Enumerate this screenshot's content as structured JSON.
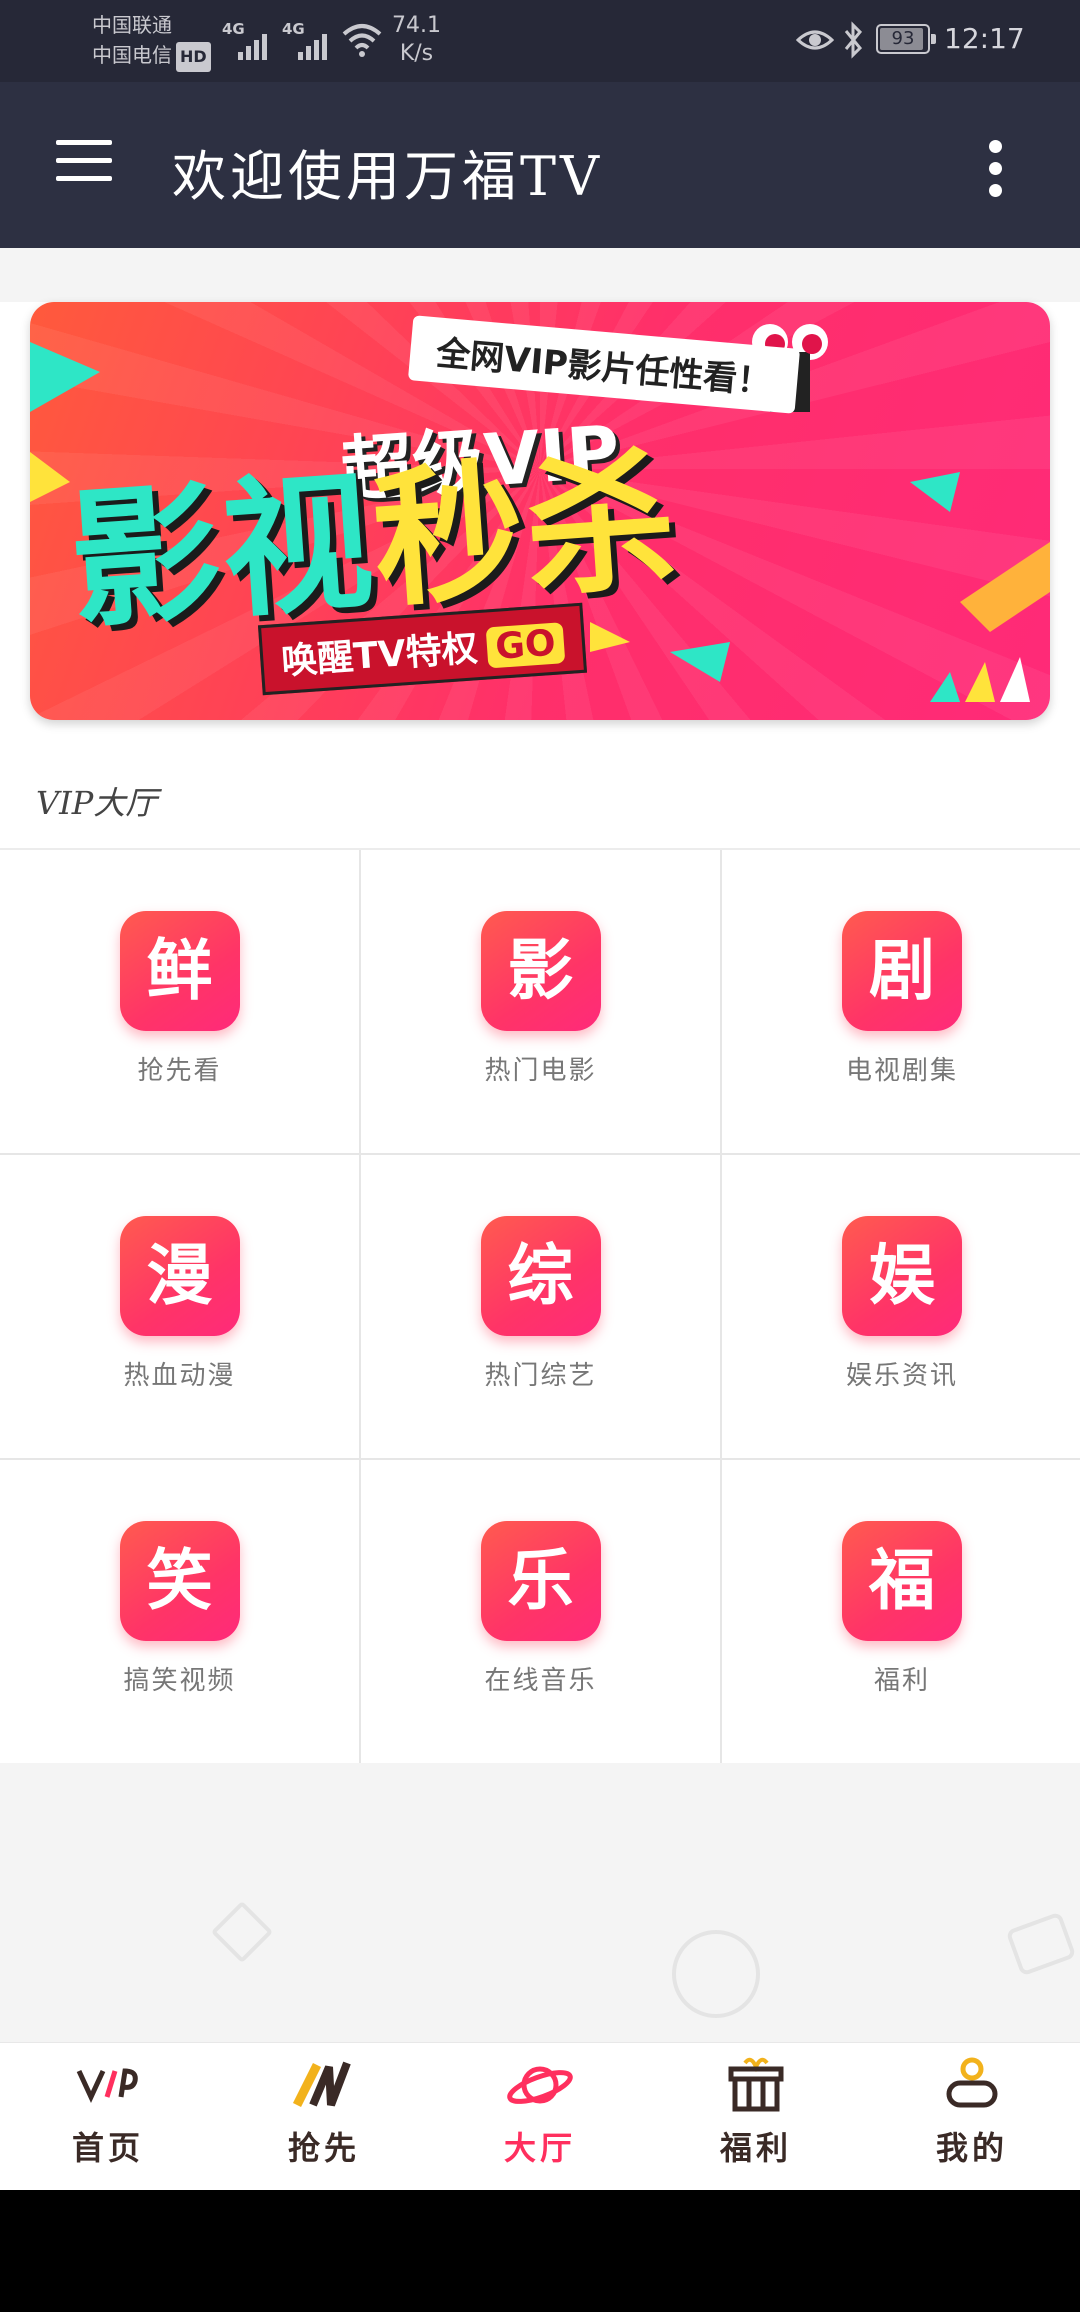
{
  "status_bar": {
    "carrier1": "中国联通",
    "carrier2": "中国电信",
    "hd_badge": "HD",
    "signal1_tag": "4G",
    "signal2_tag": "4G",
    "speed_value": "74.1",
    "speed_unit": "K/s",
    "battery": "93",
    "battery_level": 0.93,
    "time": "12:17"
  },
  "app_bar": {
    "title": "欢迎使用万福TV",
    "menu_icon": "hamburger-menu-icon",
    "more_icon": "more-vertical-icon"
  },
  "banner": {
    "subtitle": "全网VIP影片任性看！",
    "headline_top": "超级VIP",
    "headline_part1": "影视",
    "headline_part2": "秒杀",
    "badge": "唤醒TV特权",
    "badge_go": "GO"
  },
  "section": {
    "title": "VIP大厅"
  },
  "grid": {
    "items": [
      {
        "char": "鲜",
        "label": "抢先看"
      },
      {
        "char": "影",
        "label": "热门电影"
      },
      {
        "char": "剧",
        "label": "电视剧集"
      },
      {
        "char": "漫",
        "label": "热血动漫"
      },
      {
        "char": "综",
        "label": "热门综艺"
      },
      {
        "char": "娱",
        "label": "娱乐资讯"
      },
      {
        "char": "笑",
        "label": "搞笑视频"
      },
      {
        "char": "乐",
        "label": "在线音乐"
      },
      {
        "char": "福",
        "label": "福利"
      }
    ]
  },
  "bottom_nav": {
    "items": [
      {
        "label": "首页",
        "icon": "vip-icon"
      },
      {
        "label": "抢先",
        "icon": "m-logo-icon"
      },
      {
        "label": "大厅",
        "icon": "planet-icon",
        "active": true
      },
      {
        "label": "福利",
        "icon": "gift-icon"
      },
      {
        "label": "我的",
        "icon": "user-icon"
      }
    ]
  },
  "colors": {
    "app_bar_bg": "#2d3042",
    "status_bar_bg": "#262837",
    "accent": "#ff2f5e",
    "tile_gradient_start": "#ff5b4f",
    "tile_gradient_end": "#ff2a7a"
  }
}
